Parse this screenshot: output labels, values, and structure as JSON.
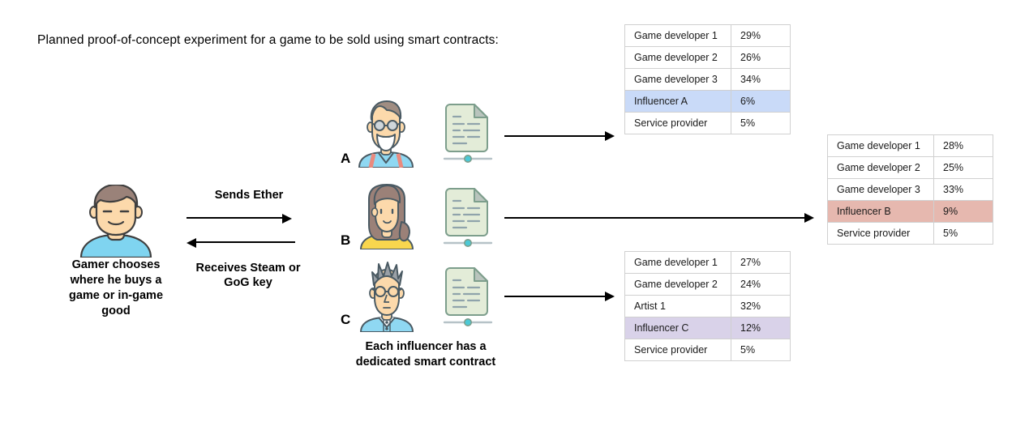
{
  "intro": {
    "text": "Planned proof-of-concept experiment for a game to be sold using smart contracts:"
  },
  "gamer": {
    "label_line1": "Gamer chooses",
    "label_line2": "where he buys a",
    "label_line3": "game or in-game",
    "label_line4": "good",
    "icon": "gamer-avatar-icon",
    "hair_color": "#9a8279",
    "skin_color": "#fcd9ab",
    "shirt_color": "#7fd4f0"
  },
  "exchange": {
    "send_label": "Sends Ether",
    "receive_label_line1": "Receives Steam or",
    "receive_label_line2": "GoG key"
  },
  "influencers": [
    {
      "letter": "A",
      "icon": "influencer-a-avatar-icon",
      "contract_icon": "smart-contract-document-icon",
      "hair_color": "#a08d82",
      "skin_color": "#fcd9ab",
      "shirt_color": "#8fd8f2",
      "accent_color": "#ea8a7e"
    },
    {
      "letter": "B",
      "icon": "influencer-b-avatar-icon",
      "contract_icon": "smart-contract-document-icon",
      "hair_color": "#9b8178",
      "skin_color": "#fcd9ab",
      "shirt_color": "#f8d64e",
      "accent_color": "#f8d64e"
    },
    {
      "letter": "C",
      "icon": "influencer-c-avatar-icon",
      "contract_icon": "smart-contract-document-icon",
      "hair_color": "#9aa0a6",
      "skin_color": "#fcd9ab",
      "shirt_color": "#8fd8f2",
      "accent_color": "#e8eaed"
    }
  ],
  "contract_caption": {
    "line1": "Each influencer has a",
    "line2": "dedicated smart contract"
  },
  "tables": {
    "table_a": {
      "name": "influencer-a-revenue-split-table",
      "highlight_color": "#c9daf8",
      "rows": [
        {
          "label": "Game developer 1",
          "value": "29%",
          "highlight": false
        },
        {
          "label": "Game developer 2",
          "value": "26%",
          "highlight": false
        },
        {
          "label": "Game developer 3",
          "value": "34%",
          "highlight": false
        },
        {
          "label": "Influencer A",
          "value": "6%",
          "highlight": true
        },
        {
          "label": "Service provider",
          "value": "5%",
          "highlight": false
        }
      ]
    },
    "table_b": {
      "name": "influencer-b-revenue-split-table",
      "highlight_color": "#e6b8af",
      "rows": [
        {
          "label": "Game developer 1",
          "value": "28%",
          "highlight": false
        },
        {
          "label": "Game developer 2",
          "value": "25%",
          "highlight": false
        },
        {
          "label": "Game developer 3",
          "value": "33%",
          "highlight": false
        },
        {
          "label": "Influencer B",
          "value": "9%",
          "highlight": true
        },
        {
          "label": "Service provider",
          "value": "5%",
          "highlight": false
        }
      ]
    },
    "table_c": {
      "name": "influencer-c-revenue-split-table",
      "highlight_color": "#d9d2e9",
      "rows": [
        {
          "label": "Game developer 1",
          "value": "27%",
          "highlight": false
        },
        {
          "label": "Game developer 2",
          "value": "24%",
          "highlight": false
        },
        {
          "label": "Artist 1",
          "value": "32%",
          "highlight": false
        },
        {
          "label": "Influencer C",
          "value": "12%",
          "highlight": true
        },
        {
          "label": "Service provider",
          "value": "5%",
          "highlight": false
        }
      ]
    }
  },
  "colors": {
    "document_fill": "#e3ecd8",
    "document_stroke": "#7d9e8c",
    "document_line": "#8fa3ab",
    "slider_dot": "#4cc9d6",
    "table_border": "#d0d0d0",
    "arrow": "#000000"
  }
}
